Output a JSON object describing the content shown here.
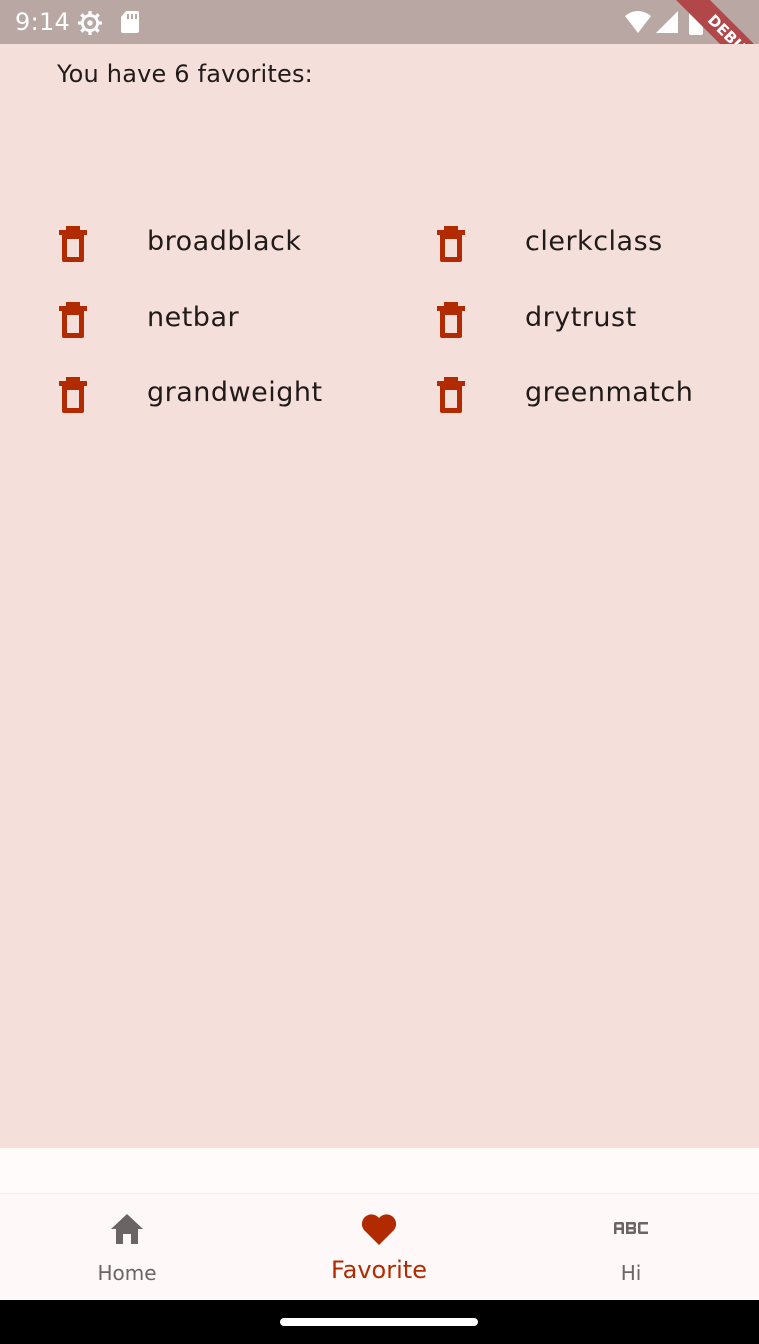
{
  "status_bar": {
    "time": "9:14",
    "icons": [
      "settings-icon",
      "sd-card-icon",
      "wifi-icon",
      "signal-icon",
      "battery-icon"
    ]
  },
  "debug_banner": {
    "label": "DEBUG"
  },
  "favorites": {
    "heading": "You have 6 favorites:",
    "items": [
      {
        "label": "broadblack"
      },
      {
        "label": "clerkclass"
      },
      {
        "label": "netbar"
      },
      {
        "label": "drytrust"
      },
      {
        "label": "grandweight"
      },
      {
        "label": "greenmatch"
      }
    ]
  },
  "bottom_nav": {
    "items": [
      {
        "label": "Home",
        "icon": "home-icon",
        "selected": false
      },
      {
        "label": "Favorite",
        "icon": "heart-icon",
        "selected": true
      },
      {
        "label": "Hi",
        "icon": "abc-icon",
        "selected": false
      }
    ]
  },
  "colors": {
    "accent": "#b22b00",
    "background": "#f5dfdb",
    "text": "#201a19",
    "inactive": "#6b6464",
    "status_bar": "#b9a7a4"
  }
}
